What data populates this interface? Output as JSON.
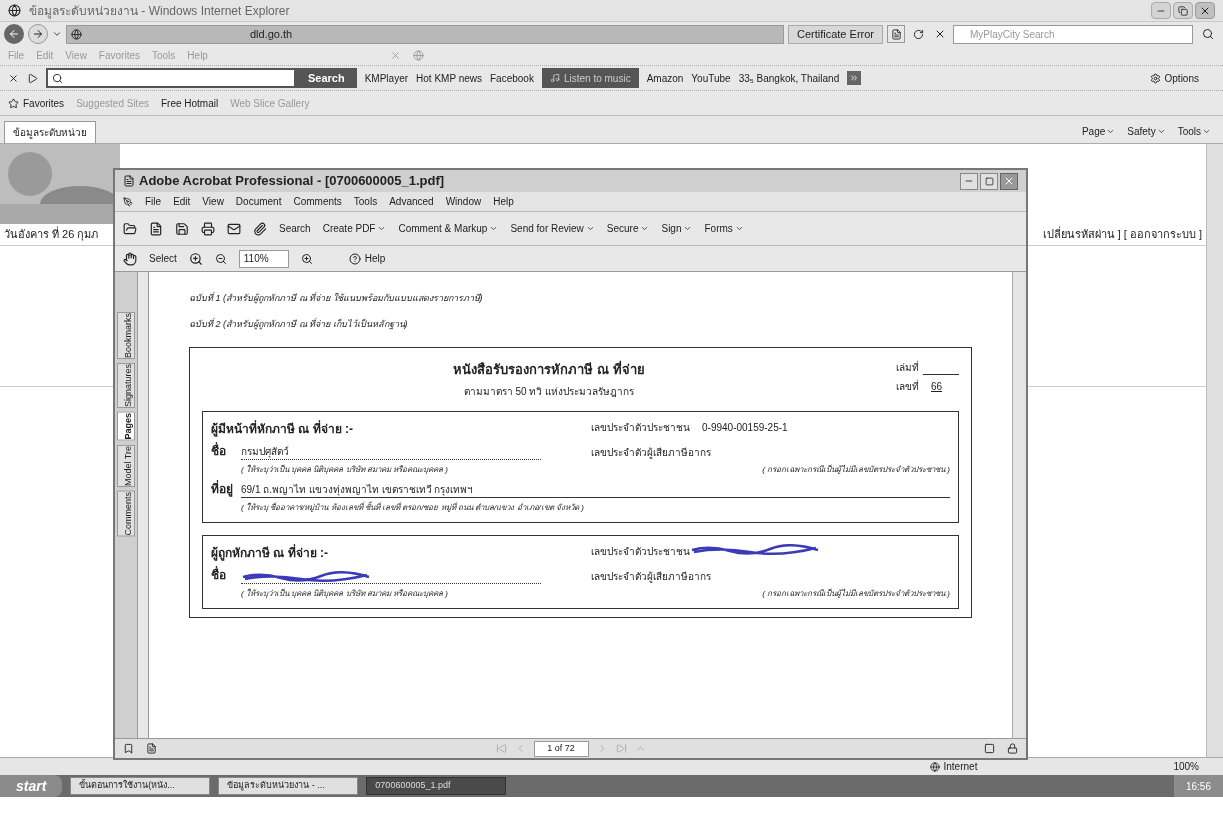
{
  "ie": {
    "title": "ข้อมูลระดับหน่วยงาน - Windows Internet Explorer",
    "address": "dld.go.th",
    "certificate": "Certificate Error",
    "search_placeholder": "MyPlayCity Search",
    "menu": [
      "File",
      "Edit",
      "View",
      "Favorites",
      "Tools",
      "Help"
    ],
    "toolbar": {
      "search_button": "Search",
      "items": [
        "KMPlayer",
        "Hot KMP news",
        "Facebook"
      ],
      "music": "Listen to music",
      "items2": [
        "Amazon",
        "YouTube",
        "33₅ Bangkok, Thailand"
      ],
      "options": "Options"
    },
    "favorites": {
      "label": "Favorites",
      "links": [
        "Suggested Sites",
        "Free Hotmail",
        "Web Slice Gallery"
      ]
    },
    "tab": "ข้อมูลระดับหน่วย",
    "commands": [
      "Page",
      "Safety",
      "Tools"
    ],
    "page": {
      "date": "วันอังคาร ที่ 26 กุมภ",
      "links": "เปลี่ยนรหัสผ่าน ] [ ออกจากระบบ ]"
    },
    "status": {
      "zone": "Internet",
      "zoom": "100%"
    }
  },
  "acrobat": {
    "title": "Adobe Acrobat Professional - [0700600005_1.pdf]",
    "menu": [
      "File",
      "Edit",
      "View",
      "Document",
      "Comments",
      "Tools",
      "Advanced",
      "Window",
      "Help"
    ],
    "toolbar": [
      "Search",
      "Create PDF",
      "Comment & Markup",
      "Send for Review",
      "Secure",
      "Sign",
      "Forms"
    ],
    "select": "Select",
    "zoom": "110%",
    "help": "Help",
    "nav_tabs": [
      {
        "label": "Bookmarks",
        "selected": false
      },
      {
        "label": "Signatures",
        "selected": false
      },
      {
        "label": "Pages",
        "selected": true
      },
      {
        "label": "Model Tre",
        "selected": false
      },
      {
        "label": "Comments",
        "selected": false
      }
    ],
    "page_indicator": "1 of 72",
    "document": {
      "copies": [
        "ฉบับที่ 1 (สำหรับผู้ถูกหักภาษี ณ ที่จ่าย ใช้แนบพร้อมกับแบบแสดงรายการภาษี)",
        "ฉบับที่ 2 (สำหรับผู้ถูกหักภาษี ณ ที่จ่าย เก็บไว้เป็นหลักฐาน)"
      ],
      "title": "หนังสือรับรองการหักภาษี ณ ที่จ่าย",
      "subtitle": "ตามมาตรา 50 ทวิ แห่งประมวลรัษฎากร",
      "book_label": "เล่มที่",
      "number_label": "เลขที่",
      "number": "66",
      "sections": [
        {
          "heading": "ผู้มีหน้าที่หักภาษี ณ ที่จ่าย :-",
          "id_label": "เลขประจำตัวประชาชน",
          "id_value": "0-9940-00159-25-1",
          "redacted_id": false,
          "name_label": "ชื่อ",
          "name_value": "กรมปศุสัตว์",
          "redacted_name": false,
          "tax_label": "เลขประจำตัวผู้เสียภาษีอากร",
          "name_hint": "( ให้ระบุว่าเป็น บุคคล นิติบุคคล บริษัท สมาคม หรือคณะบุคคล )",
          "tax_hint": "( กรอกเฉพาะกรณีเป็นผู้ไม่มีเลขบัตรประจำตัวประชาชน )",
          "address_label": "ที่อยู่",
          "address_value": "69/1 ถ.พญาไท แขวงทุ่งพญาไท เขตราชเทวี กรุงเทพฯ",
          "address_hint": "( ให้ระบุ ชื่ออาคาร/หมู่บ้าน ห้องเลขที่ ชั้นที่ เลขที่ ตรอก/ซอย หมู่ที่ ถนน ตำบล/แขวง อำเภอ/เขต จังหวัด )"
        },
        {
          "heading": "ผู้ถูกหักภาษี ณ ที่จ่าย :-",
          "id_label": "เลขประจำตัวประชาชน",
          "redacted_id": true,
          "name_label": "ชื่อ",
          "redacted_name": true,
          "tax_label": "เลขประจำตัวผู้เสียภาษีอากร",
          "name_hint": "( ให้ระบุว่าเป็น บุคคล นิติบุคคล บริษัท สมาคม หรือคณะบุคคล )",
          "tax_hint": "( กรอกเฉพาะกรณีเป็นผู้ไม่มีเลขบัตรประจำตัวประชาชน )"
        }
      ]
    }
  },
  "taskbar": {
    "start": "start",
    "tasks": [
      {
        "label": "ขั้นตอนการใช้งาน(หนัง...",
        "selected": false
      },
      {
        "label": "ข้อมูลระดับหน่วยงาน - ...",
        "selected": false
      },
      {
        "label": "0700600005_1.pdf",
        "selected": true
      }
    ],
    "clock": "16:56"
  }
}
